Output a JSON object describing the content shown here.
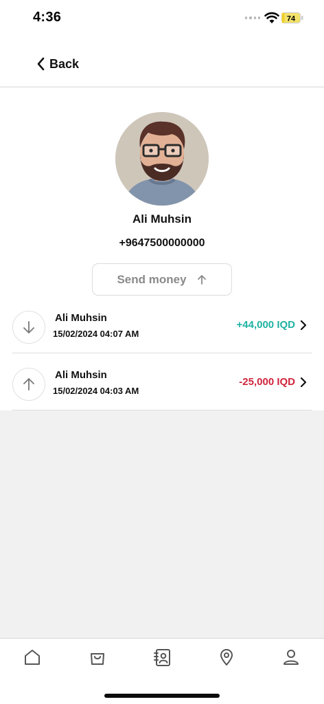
{
  "status_bar": {
    "time": "4:36",
    "battery_level": "74"
  },
  "nav": {
    "back_label": "Back"
  },
  "profile": {
    "name": "Ali Muhsin",
    "phone": "+9647500000000"
  },
  "actions": {
    "send_money_label": "Send money"
  },
  "transactions": [
    {
      "name": "Ali Muhsin",
      "datetime": "15/02/2024 04:07 AM",
      "amount": "+44,000 IQD",
      "direction": "incoming",
      "icon": "arrow-down-icon",
      "color": "#1fb2a2"
    },
    {
      "name": "Ali Muhsin",
      "datetime": "15/02/2024 04:03 AM",
      "amount": "-25,000 IQD",
      "direction": "outgoing",
      "icon": "arrow-up-icon",
      "color": "#d0243c"
    }
  ],
  "tabbar": {
    "items": [
      {
        "icon": "home-icon"
      },
      {
        "icon": "shopping-bag-icon"
      },
      {
        "icon": "contacts-book-icon"
      },
      {
        "icon": "location-pin-icon"
      },
      {
        "icon": "profile-icon"
      }
    ]
  },
  "colors": {
    "incoming": "#1fb2a2",
    "outgoing": "#d0243c",
    "background": "#f1f1f1"
  }
}
